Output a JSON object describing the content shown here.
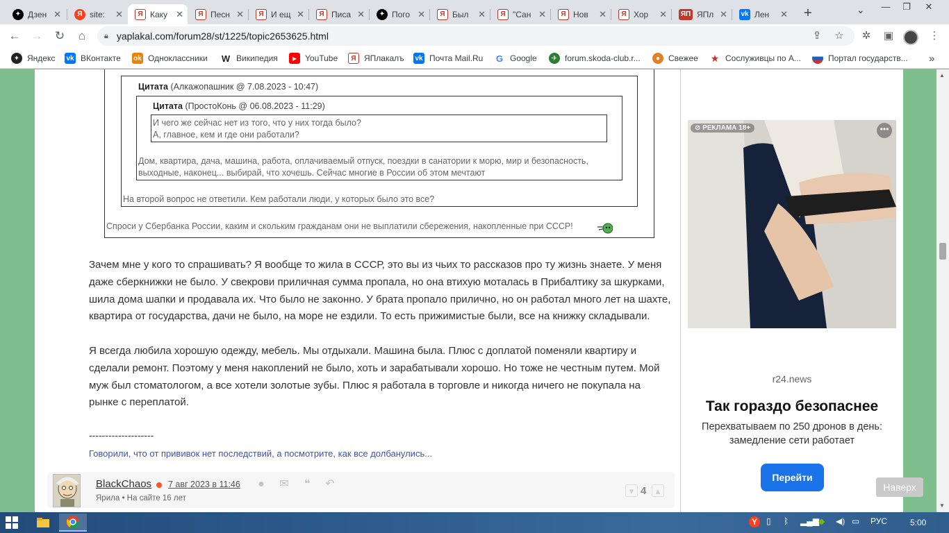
{
  "browser": {
    "tabs": [
      {
        "label": "Дзен",
        "icon": "zen"
      },
      {
        "label": "site:",
        "icon": "yandex"
      },
      {
        "label": "Каку",
        "icon": "yaplakal",
        "active": true
      },
      {
        "label": "Песн",
        "icon": "yaplakal"
      },
      {
        "label": "И ещ",
        "icon": "yaplakal"
      },
      {
        "label": "Писа",
        "icon": "yaplakal"
      },
      {
        "label": "Пого",
        "icon": "zen"
      },
      {
        "label": "Был",
        "icon": "yaplakal"
      },
      {
        "label": "\"Сан",
        "icon": "yaplakal"
      },
      {
        "label": "Нов",
        "icon": "yaplakal"
      },
      {
        "label": "Хор",
        "icon": "yaplakal"
      },
      {
        "label": "ЯПл",
        "icon": "yap-logo"
      },
      {
        "label": "Лен",
        "icon": "vk"
      }
    ],
    "new_tab": "+",
    "url": "yaplakal.com/forum28/st/1225/topic2653625.html",
    "bookmarks": [
      {
        "label": "Яндекс",
        "icon": "yandex"
      },
      {
        "label": "ВКонтакте",
        "icon": "vk"
      },
      {
        "label": "Одноклассники",
        "icon": "ok"
      },
      {
        "label": "Википедия",
        "icon": "wikipedia"
      },
      {
        "label": "YouTube",
        "icon": "youtube"
      },
      {
        "label": "ЯПлакалъ",
        "icon": "yaplakal"
      },
      {
        "label": "Почта Mail.Ru",
        "icon": "vk"
      },
      {
        "label": "Google",
        "icon": "google"
      },
      {
        "label": "forum.skoda-club.r...",
        "icon": "skoda"
      },
      {
        "label": "Свежее",
        "icon": "pikabu"
      },
      {
        "label": "Сослуживцы по А...",
        "icon": "star"
      },
      {
        "label": "Портал государств...",
        "icon": "gosuslugi"
      }
    ],
    "bookmarks_more": "»"
  },
  "post": {
    "quote_outer": {
      "label": "Цитата",
      "meta": "(Алкажопашник @ 7.08.2023 - 10:47)",
      "text": "На второй вопрос не ответили. Кем работали люди, у которых было это все?"
    },
    "quote_middle": {
      "label": "Цитата",
      "meta": "(ПростоКонь @ 06.08.2023 - 11:29)",
      "text_line1": "Дом, квартира, дача, машина, работа, оплачиваемый отпуск, поездки в санатории к морю, мир и безопасность,",
      "text_line2": "выходные, наконец... выбирай, что хочешь. Сейчас многие в России об этом мечтают"
    },
    "quote_inner": {
      "text_line1": "И чего же сейчас нет из того, что у них тогда было?",
      "text_line2": "А, главное, кем и где они работали?"
    },
    "quote_bottom_text": "Спроси у Сбербанка России, каким и скольким гражданам они не выплатили сбережения, накопленные при СССР!",
    "paragraph1": "Зачем мне у кого то спрашивать? Я вообще то жила в СССР, это вы из чьих то рассказов про ту жизнь знаете. У меня даже сберкнижки не было. У свекрови приличная сумма пропала, но она втихую моталась в Прибалтику за шкурками, шила дома шапки и продавала их. Что было не законно. У брата пропало прилично, но он работал много лет на шахте, квартира от государства, дачи не было, на море не ездили. То есть прижимистые были, все на книжку складывали.",
    "paragraph2": "Я всегда любила хорошую одежду, мебель. Мы отдыхали. Машина была. Плюс с доплатой поменяли квартиру и сделали ремонт. Поэтому у меня накоплений не было, хоть и зарабатывали хорошо. Но тоже не честным путем. Мой муж был стоматологом, а все хотели золотые зубы. Плюс я работала в торговле и никогда ничего не покупала на рынке с переплатой.",
    "signature_separator": "--------------------",
    "signature_link": "Говорили, что от прививок нет последствий, а посмотрите, как все долбанулись..."
  },
  "next_post": {
    "username": "BlackChaos",
    "date": "7 авг 2023 в 11:46",
    "rank": "Ярила",
    "meta_separator": "•",
    "on_site": "На сайте 16 лет",
    "rating": "4"
  },
  "ad": {
    "label": "РЕКЛАМА 18+",
    "domain": "r24.news",
    "title": "Так гораздо безопаснее",
    "text": "Перехватываем по 250 дронов в день: замедление сети работает",
    "button": "Перейти"
  },
  "to_top": "Наверх",
  "taskbar": {
    "lang": "РУС",
    "time": "5:00"
  },
  "colors": {
    "page_bg": "#7fbf8e",
    "link": "#3f51b5",
    "ad_button": "#1a73e8",
    "online_dot": "#ff5722"
  }
}
